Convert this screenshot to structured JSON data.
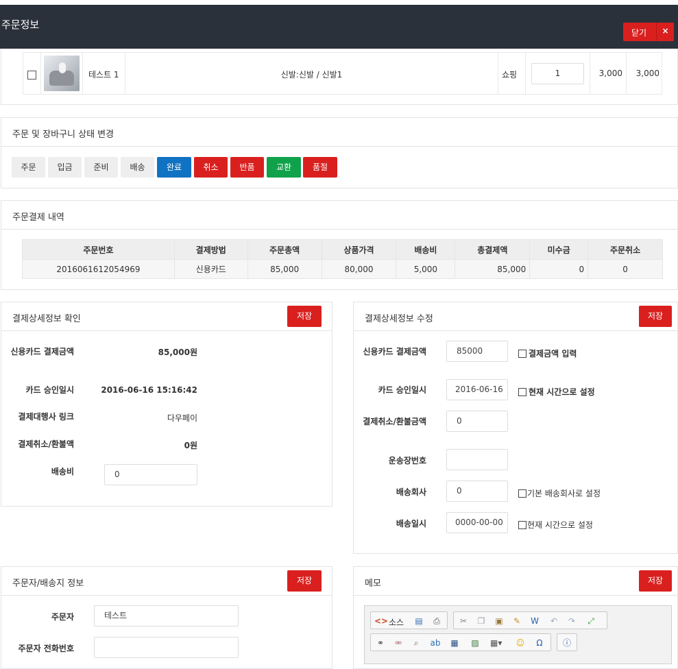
{
  "modal": {
    "title": "주문정보",
    "close_label": "닫기",
    "close_x": "×"
  },
  "product": {
    "name": "테스트 1",
    "option": "신발:신발 / 신발1",
    "type": "쇼핑",
    "qty": "1",
    "price": "3,000",
    "total": "3,000"
  },
  "status_panel": {
    "title": "주문 및 장바구니 상태 변경",
    "buttons": [
      "주문",
      "입금",
      "준비",
      "배송",
      "완료",
      "취소",
      "반품",
      "교환",
      "품절"
    ]
  },
  "payment_panel": {
    "title": "주문결제 내역",
    "headers": [
      "주문번호",
      "결제방법",
      "주문총액",
      "상품가격",
      "배송비",
      "총결제액",
      "미수금",
      "주문취소"
    ],
    "row": [
      "2016061612054969",
      "신용카드",
      "85,000",
      "80,000",
      "5,000",
      "85,000",
      "0",
      "0"
    ]
  },
  "confirm_panel": {
    "title": "결제상세정보 확인",
    "save": "저장",
    "card_amount_label": "신용카드 결제금액",
    "card_amount": "85,000원",
    "approved_label": "카드 승인일시",
    "approved": "2016-06-16 15:16:42",
    "pg_label": "결제대행사 링크",
    "pg": "다우페이",
    "refund_label": "결제취소/환불액",
    "refund": "0원",
    "shipping_label": "배송비",
    "shipping": "0"
  },
  "edit_panel": {
    "title": "결제상세정보 수정",
    "save": "저장",
    "card_amount_label": "신용카드 결제금액",
    "card_amount": "85000",
    "card_amount_chk": "결제금액 입력",
    "approved_label": "카드 승인일시",
    "approved": "2016-06-16",
    "approved_chk": "현재 시간으로 설정",
    "refund_label": "결제취소/환불금액",
    "refund": "0",
    "tracking_label": "운송장번호",
    "tracking": "",
    "courier_label": "배송회사",
    "courier": "0",
    "courier_chk": "기본 배송회사로 설정",
    "ship_date_label": "배송일시",
    "ship_date": "0000-00-00",
    "ship_date_chk": "현재 시간으로 설정"
  },
  "customer_panel": {
    "title": "주문자/배송지 정보",
    "save": "저장",
    "orderer_label": "주문자",
    "orderer": "테스트",
    "phone_label": "주문자 전화번호",
    "phone": ""
  },
  "memo_panel": {
    "title": "메모",
    "save": "저장",
    "source_label": "소스"
  }
}
